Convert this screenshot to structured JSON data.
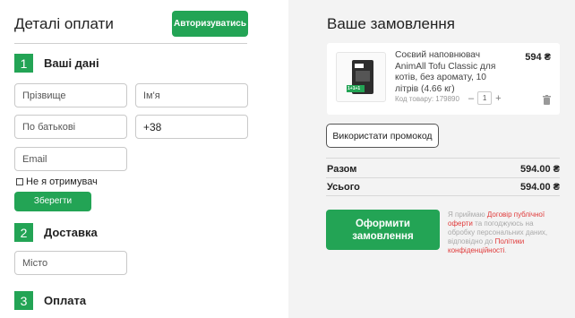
{
  "checkout": {
    "title": "Деталі оплати",
    "login_button": "Авторизуватись",
    "steps": [
      {
        "num": "1",
        "label": "Ваші дані"
      },
      {
        "num": "2",
        "label": "Доставка"
      },
      {
        "num": "3",
        "label": "Оплата"
      }
    ],
    "fields": {
      "last_name": "Прізвище",
      "first_name": "Ім'я",
      "middle_name": "По батькові",
      "phone": "+38",
      "email": "Email",
      "city": "Місто"
    },
    "not_recipient_label": "Не я отримувач",
    "save_button": "Зберегти"
  },
  "order": {
    "title": "Ваше замовлення",
    "product": {
      "name": "Соєвий наповнювач AnimAll Tofu Classic для котів, без аромату, 10 літрів (4.66 кг)",
      "price": "594 ₴",
      "sku": "Код товару: 179890",
      "quantity": "1",
      "minus": "–",
      "plus": "+",
      "thumb_badge": "1+1+1"
    },
    "promo_button": "Використати промокод",
    "subtotal_label": "Разом",
    "subtotal_value": "594.00 ₴",
    "total_label": "Усього",
    "total_value": "594.00 ₴",
    "submit_button": "Оформити замовлення",
    "legal": {
      "p1": "Я приймаю ",
      "link1": "Договір публічної оферти",
      "p2": " та погоджуюсь на обробку персональних даних, відповідно до ",
      "link2": "Політики конфіденційності",
      "p3": "."
    }
  },
  "colors": {
    "accent": "#23a455",
    "link": "#e03a3a",
    "panel": "#f3f3f3"
  }
}
